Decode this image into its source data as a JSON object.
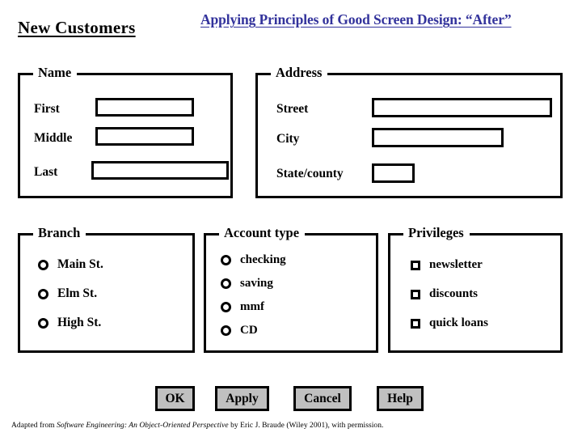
{
  "page": {
    "heading_left": "New Customers",
    "heading_right": "Applying Principles of Good Screen Design: “After”",
    "heading_right_color": "#33339c",
    "background_color": "#ffffff",
    "border_color": "#000000",
    "button_face_color": "#c0c0c0"
  },
  "groups": {
    "name": {
      "legend": "Name",
      "fields": [
        {
          "label": "First",
          "value": "",
          "placeholder": ""
        },
        {
          "label": "Middle",
          "value": "",
          "placeholder": ""
        },
        {
          "label": "Last",
          "value": "",
          "placeholder": ""
        }
      ]
    },
    "address": {
      "legend": "Address",
      "fields": [
        {
          "label": "Street",
          "value": "",
          "placeholder": ""
        },
        {
          "label": "City",
          "value": "",
          "placeholder": ""
        },
        {
          "label": "State/county",
          "value": "",
          "placeholder": ""
        }
      ]
    },
    "branch": {
      "legend": "Branch",
      "options": [
        {
          "label": "Main St.",
          "selected": false
        },
        {
          "label": "Elm St.",
          "selected": false
        },
        {
          "label": "High St.",
          "selected": false
        }
      ]
    },
    "account_type": {
      "legend": "Account type",
      "options": [
        {
          "label": "checking",
          "selected": false
        },
        {
          "label": "saving",
          "selected": false
        },
        {
          "label": "mmf",
          "selected": false
        },
        {
          "label": "CD",
          "selected": false
        }
      ]
    },
    "privileges": {
      "legend": "Privileges",
      "options": [
        {
          "label": "newsletter",
          "checked": false
        },
        {
          "label": "discounts",
          "checked": false
        },
        {
          "label": "quick loans",
          "checked": false
        }
      ]
    }
  },
  "buttons": [
    {
      "label": "OK"
    },
    {
      "label": "Apply"
    },
    {
      "label": "Cancel"
    },
    {
      "label": "Help"
    }
  ],
  "footer": {
    "prefix": "Adapted from ",
    "title_italic": "Software Engineering: An Object-Oriented Perspective",
    "suffix": " by Eric J. Braude (Wiley 2001), with permission."
  }
}
